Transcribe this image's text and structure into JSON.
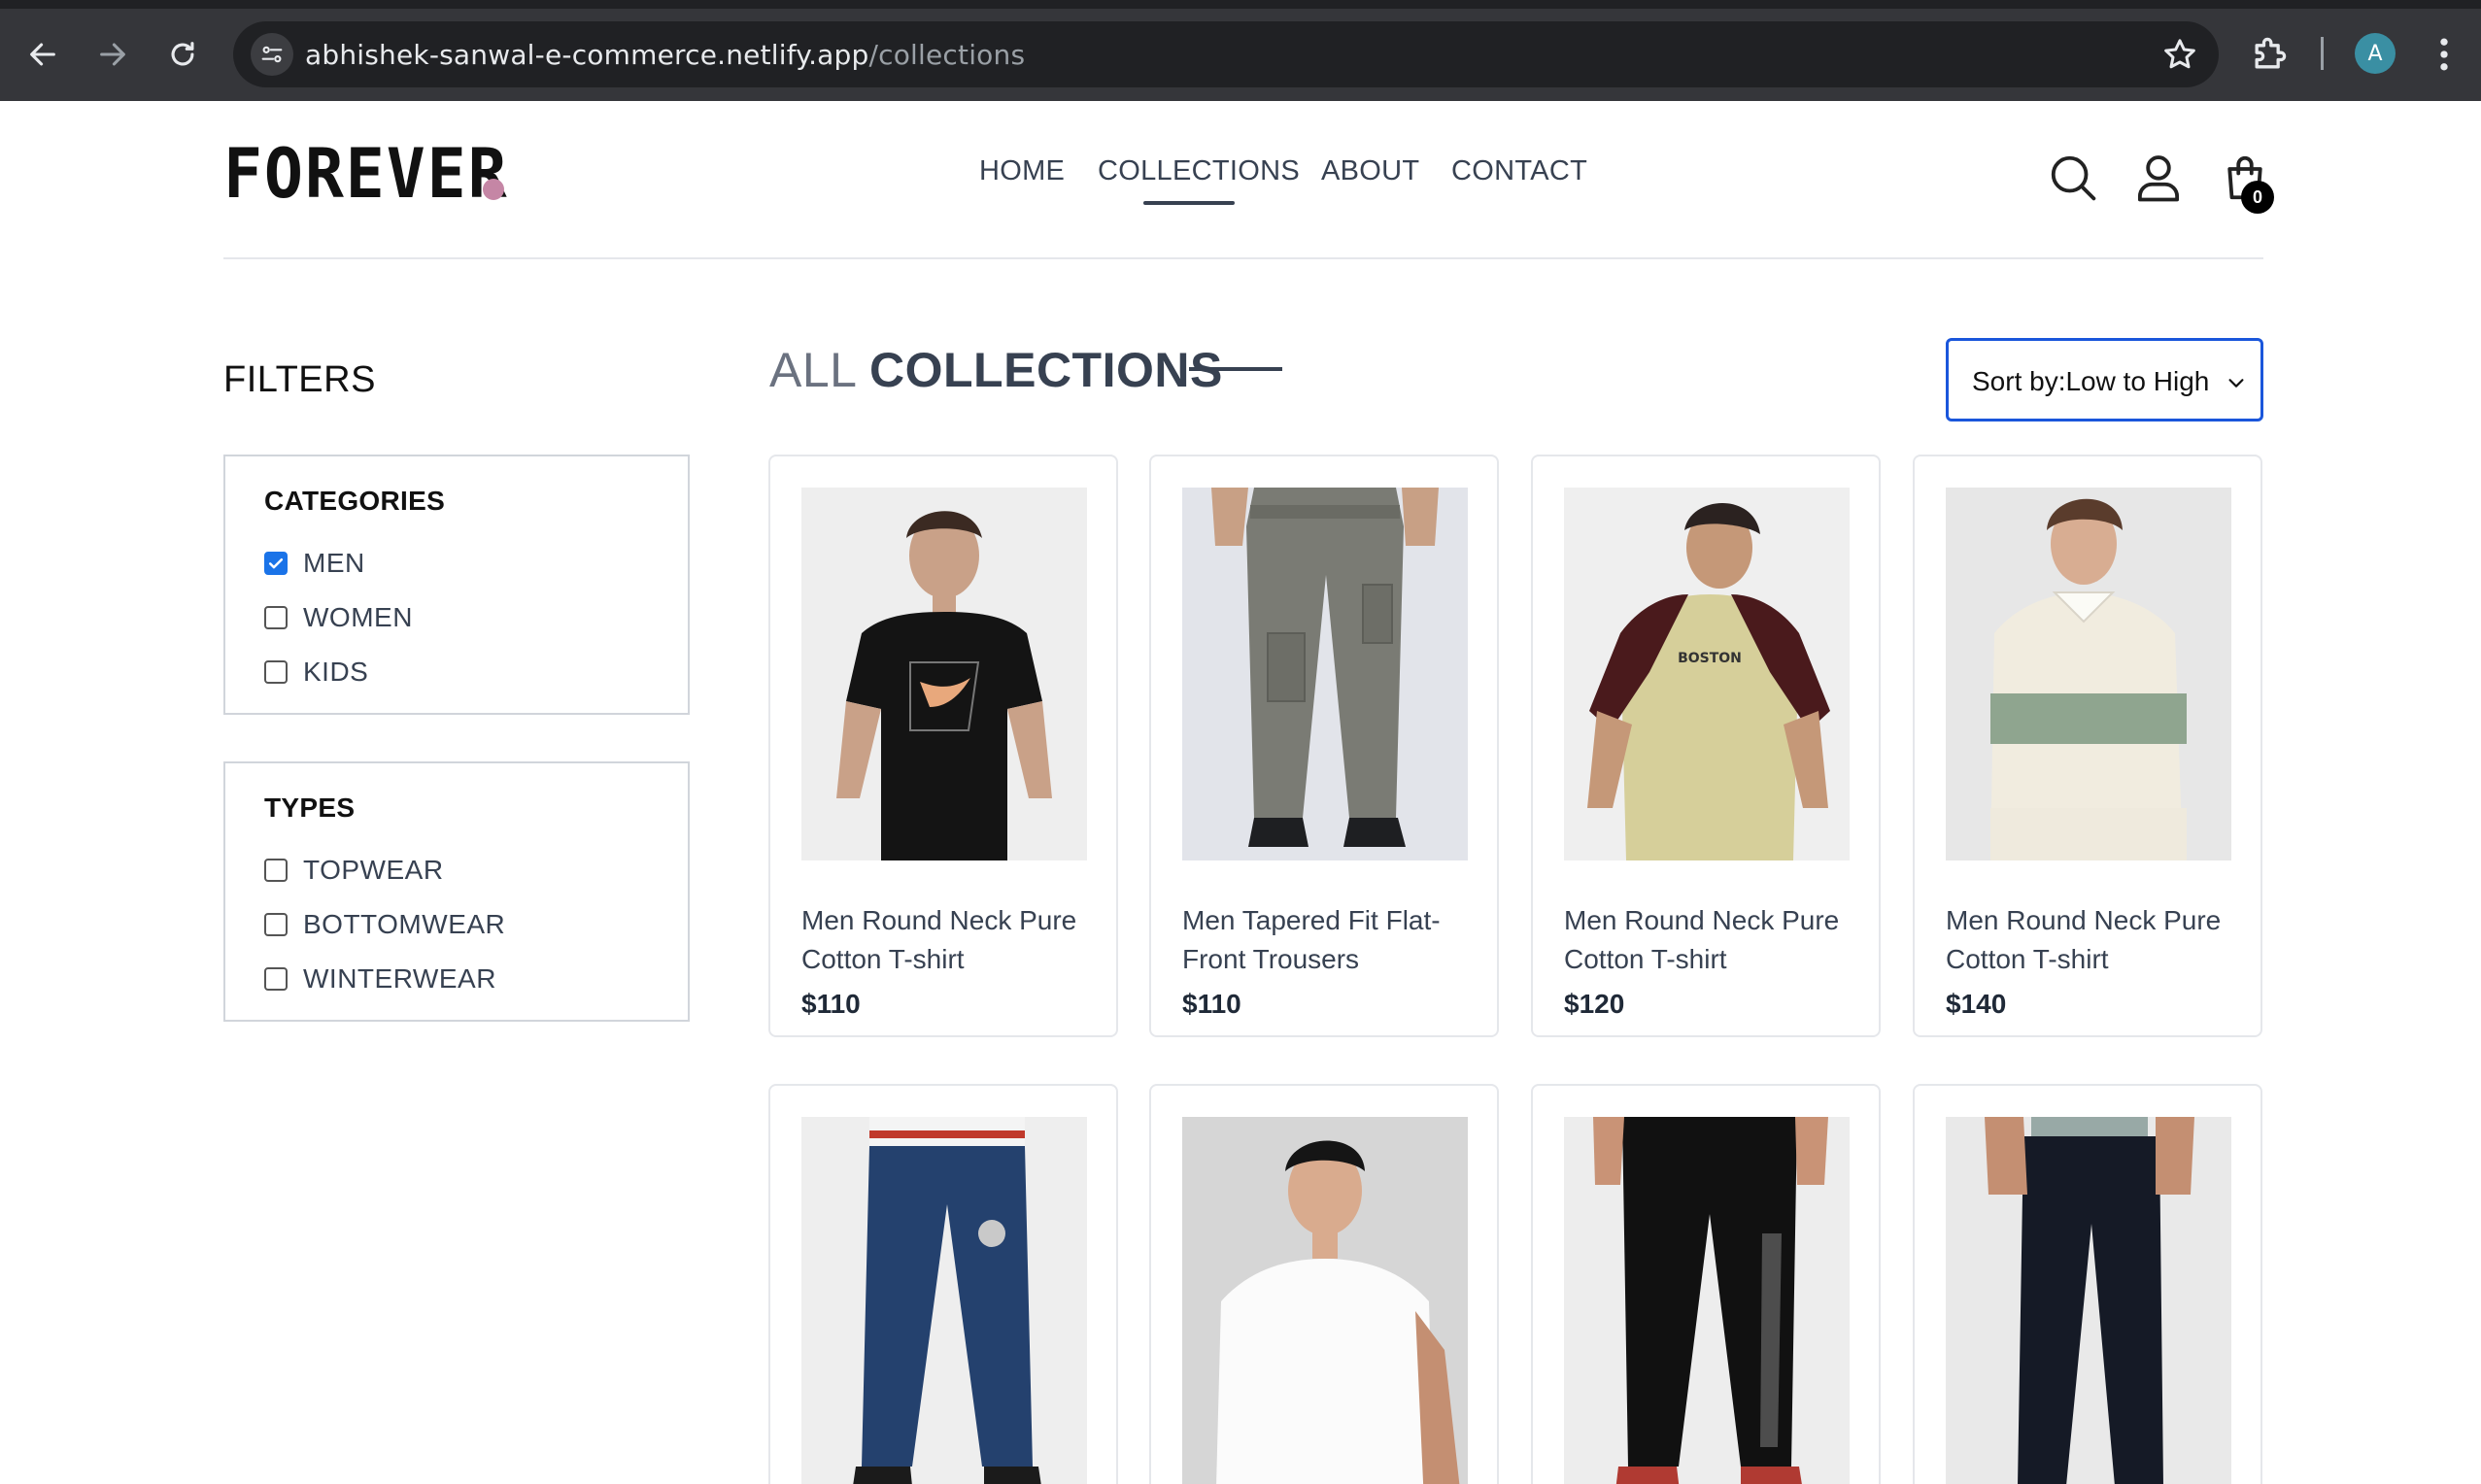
{
  "browser": {
    "url_host": "abhishek-sanwal-e-commerce.netlify.app",
    "url_path": "/collections",
    "profile_initial": "A",
    "icons": [
      "back-icon",
      "forward-icon",
      "reload-icon",
      "site-info-icon",
      "star-icon",
      "extensions-icon",
      "kebab-menu-icon"
    ]
  },
  "header": {
    "logo": "FOREVER",
    "nav": [
      "HOME",
      "COLLECTIONS",
      "ABOUT",
      "CONTACT"
    ],
    "active_nav": "COLLECTIONS",
    "cart_count": "0",
    "icons": [
      "search-icon",
      "profile-icon",
      "cart-icon"
    ]
  },
  "filters": {
    "title": "FILTERS",
    "categories": {
      "title": "CATEGORIES",
      "options": [
        {
          "label": "MEN",
          "checked": true
        },
        {
          "label": "WOMEN",
          "checked": false
        },
        {
          "label": "KIDS",
          "checked": false
        }
      ]
    },
    "types": {
      "title": "TYPES",
      "options": [
        {
          "label": "TOPWEAR",
          "checked": false
        },
        {
          "label": "BOTTOMWEAR",
          "checked": false
        },
        {
          "label": "WINTERWEAR",
          "checked": false
        }
      ]
    }
  },
  "collections": {
    "title_prefix": "ALL",
    "title_main": "COLLECTIONS",
    "sort_label": "Sort by:Low to High"
  },
  "products": [
    {
      "name": "Men Round Neck Pure Cotton T-shirt",
      "price": "$110"
    },
    {
      "name": "Men Tapered Fit Flat-Front Trousers",
      "price": "$110"
    },
    {
      "name": "Men Round Neck Pure Cotton T-shirt",
      "price": "$120"
    },
    {
      "name": "Men Round Neck Pure Cotton T-shirt",
      "price": "$140"
    }
  ],
  "theme": {
    "accent": "#1a56db",
    "checkbox": "#1a73e8",
    "logo_dot": "#c586a5",
    "chrome_bg": "#35363a"
  }
}
